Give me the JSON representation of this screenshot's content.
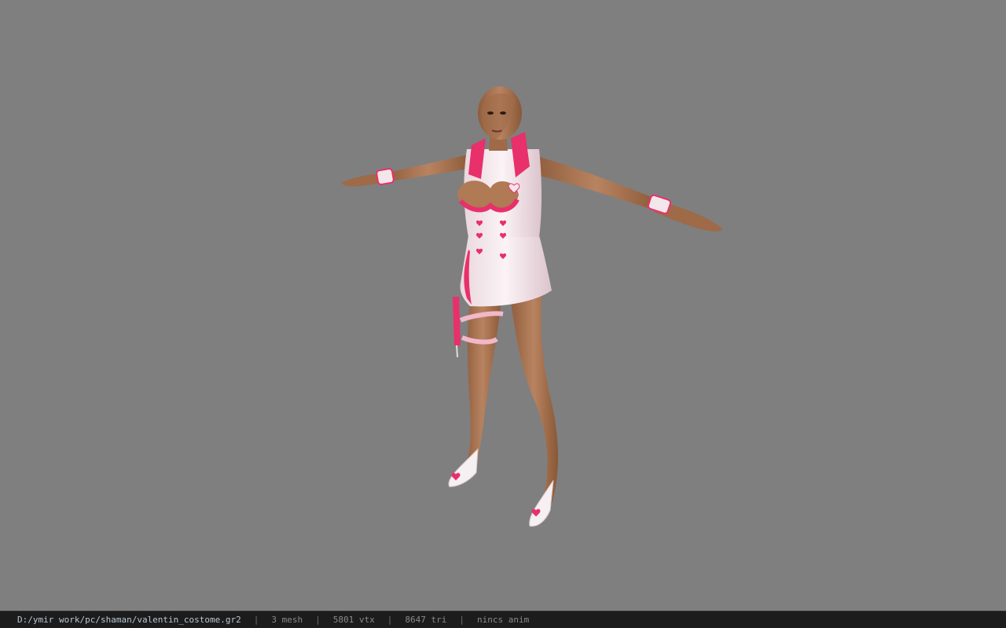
{
  "viewport": {
    "background": "#7f7f7f",
    "model_label": "3d-character-model"
  },
  "statusbar": {
    "file_path": "D:/ymir work/pc/shaman/valentin_costome.gr2",
    "separator": "|",
    "mesh": "3 mesh",
    "vertices": "5801 vtx",
    "triangles": "8647 tri",
    "anim": "nincs anim"
  },
  "colors": {
    "skin": "#b07a55",
    "outfit_white": "#f1e6ea",
    "outfit_pink": "#e8306b",
    "statusbar_bg": "#1c1c1c"
  }
}
